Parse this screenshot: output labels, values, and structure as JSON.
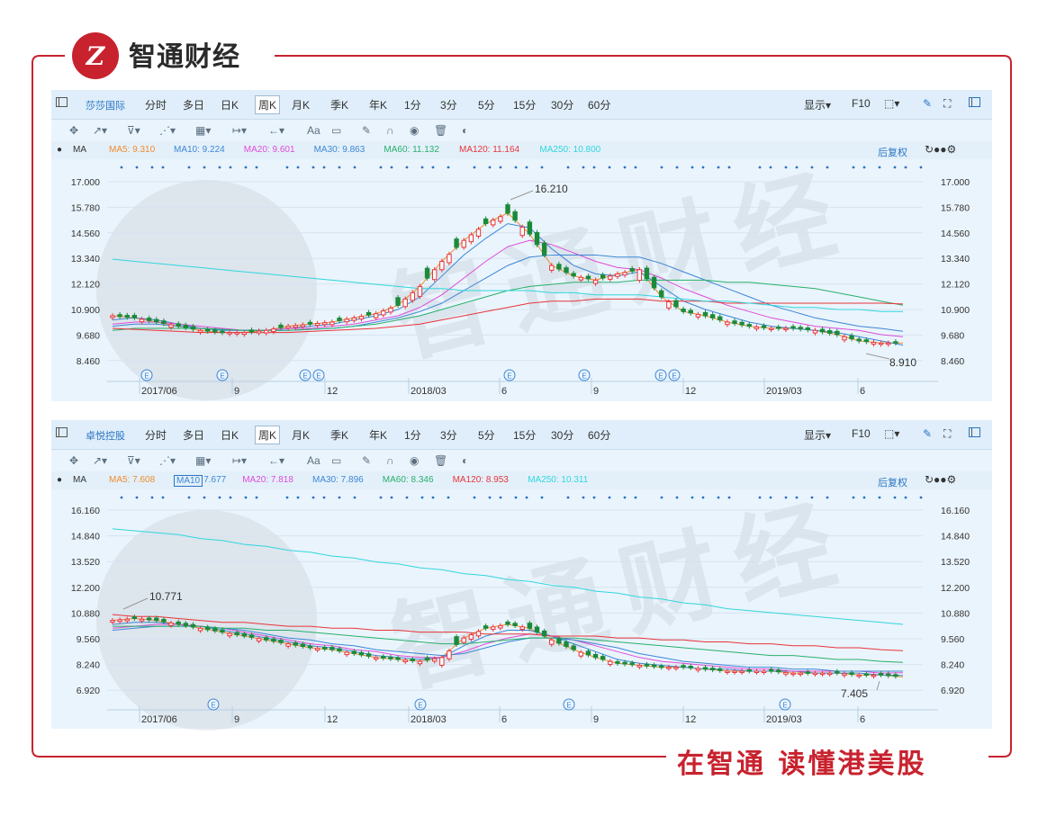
{
  "brand": {
    "name": "智通财经",
    "logo_letter": "Z",
    "slogan": "在智通 读懂港美股"
  },
  "colors": {
    "accent": "#c8222e",
    "panel_bg": "#eaf4fc",
    "up": "#e8343a",
    "down": "#1a8a3a"
  },
  "watermark": {
    "text": "智通财经"
  },
  "toolbar": {
    "periods": [
      "分时",
      "多日",
      "日K",
      "周K",
      "月K",
      "季K",
      "年K",
      "1分",
      "3分",
      "5分",
      "15分",
      "30分",
      "60分"
    ],
    "active_period": "周K",
    "display_label": "显示▾",
    "f10_label": "F10",
    "tool_glyphs": [
      "✥",
      "↗▾",
      "⊽▾",
      "⋰▾",
      "▦▾",
      "↦▾",
      "←▾",
      "Aa",
      "▭",
      "✎",
      "∩",
      "◉",
      "🗑",
      "◐"
    ]
  },
  "charts": [
    {
      "stock_name": "莎莎国际",
      "ma_label": "MA",
      "ma_values": [
        {
          "label": "MA5: 9.310",
          "color": "#f08b2b"
        },
        {
          "label": "MA10: 9.224",
          "color": "#3c86d6"
        },
        {
          "label": "MA20: 9.601",
          "color": "#e04bd8"
        },
        {
          "label": "MA30: 9.863",
          "color": "#3c86d6"
        },
        {
          "label": "MA60: 11.132",
          "color": "#27b06b"
        },
        {
          "label": "MA120: 11.164",
          "color": "#e8343a"
        },
        {
          "label": "MA250: 10.800",
          "color": "#31d6dd"
        }
      ],
      "adjust_label": "后复权",
      "y_ticks": [
        "17.000",
        "15.780",
        "14.560",
        "13.340",
        "12.120",
        "10.900",
        "9.680",
        "8.460"
      ],
      "x_ticks": [
        "2017/06",
        "9",
        "12",
        "2018/03",
        "6",
        "9",
        "12",
        "2019/03",
        "6"
      ],
      "max_label": "16.210",
      "min_label": "8.910",
      "event_marker": "E"
    },
    {
      "stock_name": "卓悦控股",
      "ma_label": "MA",
      "ma_values": [
        {
          "label": "MA5: 7.608",
          "color": "#f08b2b"
        },
        {
          "label": "MA10",
          "color": "#3c86d6",
          "boxed": true
        },
        {
          "label": "7.677",
          "color": "#3c86d6"
        },
        {
          "label": "MA20: 7.818",
          "color": "#e04bd8"
        },
        {
          "label": "MA30: 7.896",
          "color": "#3c86d6"
        },
        {
          "label": "MA60: 8.346",
          "color": "#27b06b"
        },
        {
          "label": "MA120: 8.953",
          "color": "#e8343a"
        },
        {
          "label": "MA250: 10.311",
          "color": "#31d6dd"
        }
      ],
      "adjust_label": "后复权",
      "y_ticks": [
        "16.160",
        "14.840",
        "13.520",
        "12.200",
        "10.880",
        "9.560",
        "8.240",
        "6.920"
      ],
      "x_ticks": [
        "2017/06",
        "9",
        "12",
        "2018/03",
        "6",
        "9",
        "12",
        "2019/03",
        "6"
      ],
      "max_label": "10.771",
      "min_label": "7.405",
      "event_marker": "E"
    }
  ],
  "chart_data": [
    {
      "type": "line",
      "title": "",
      "candlestick": true,
      "y_axis": [
        8.46,
        17.0
      ],
      "x_axis": [
        "2017/06",
        "9",
        "12",
        "2018/03",
        "6",
        "9",
        "12",
        "2019/03",
        "6"
      ],
      "annotations": [
        {
          "label": "16.210",
          "kind": "max"
        },
        {
          "label": "8.910",
          "kind": "min"
        }
      ],
      "series": [
        {
          "name": "MA5",
          "color": "#f08b2b",
          "values": [
            10.6,
            10.5,
            10.3,
            10.1,
            9.9,
            9.8,
            9.8,
            9.9,
            10.1,
            10.2,
            10.3,
            10.5,
            10.7,
            11.1,
            12.0,
            13.2,
            14.2,
            15.0,
            15.5,
            14.5,
            13.0,
            12.5,
            12.3,
            12.6,
            12.8,
            11.5,
            10.8,
            10.6,
            10.3,
            10.1,
            10.0,
            10.0,
            9.9,
            9.7,
            9.4,
            9.3,
            9.3
          ]
        },
        {
          "name": "MA10",
          "color": "#3c86d6",
          "values": [
            10.4,
            10.5,
            10.4,
            10.2,
            10.0,
            9.9,
            9.9,
            9.9,
            10.0,
            10.1,
            10.2,
            10.4,
            10.6,
            10.9,
            11.5,
            12.5,
            13.5,
            14.3,
            15.0,
            14.8,
            13.8,
            13.0,
            12.6,
            12.5,
            12.7,
            12.0,
            11.3,
            10.9,
            10.6,
            10.3,
            10.1,
            10.0,
            9.9,
            9.8,
            9.6,
            9.4,
            9.2
          ]
        },
        {
          "name": "MA20",
          "color": "#e04bd8",
          "values": [
            10.2,
            10.3,
            10.3,
            10.2,
            10.1,
            10.0,
            9.9,
            9.9,
            10.0,
            10.0,
            10.1,
            10.2,
            10.4,
            10.6,
            11.0,
            11.6,
            12.4,
            13.2,
            13.9,
            14.2,
            14.0,
            13.6,
            13.2,
            12.9,
            12.8,
            12.4,
            11.9,
            11.5,
            11.1,
            10.8,
            10.5,
            10.3,
            10.1,
            10.0,
            9.9,
            9.7,
            9.6
          ]
        },
        {
          "name": "MA30",
          "color": "#3c86d6",
          "values": [
            10.1,
            10.2,
            10.2,
            10.1,
            10.0,
            9.95,
            9.9,
            9.9,
            9.9,
            9.95,
            10.0,
            10.1,
            10.3,
            10.5,
            10.8,
            11.2,
            11.8,
            12.4,
            13.0,
            13.4,
            13.5,
            13.5,
            13.5,
            13.4,
            13.4,
            13.1,
            12.7,
            12.3,
            11.9,
            11.5,
            11.1,
            10.8,
            10.5,
            10.3,
            10.1,
            10.0,
            9.86
          ]
        },
        {
          "name": "MA60",
          "color": "#27b06b",
          "values": [
            9.9,
            10.0,
            10.0,
            10.0,
            10.0,
            9.95,
            9.9,
            9.9,
            9.9,
            9.95,
            10.0,
            10.1,
            10.2,
            10.4,
            10.6,
            10.9,
            11.2,
            11.5,
            11.8,
            12.0,
            12.1,
            12.2,
            12.2,
            12.2,
            12.3,
            12.3,
            12.3,
            12.3,
            12.2,
            12.2,
            12.1,
            12.0,
            11.9,
            11.7,
            11.5,
            11.3,
            11.1
          ]
        },
        {
          "name": "MA120",
          "color": "#e8343a",
          "values": [
            10.0,
            9.95,
            9.9,
            9.85,
            9.8,
            9.8,
            9.8,
            9.8,
            9.8,
            9.85,
            9.9,
            9.95,
            10.0,
            10.1,
            10.2,
            10.4,
            10.6,
            10.8,
            11.0,
            11.2,
            11.3,
            11.3,
            11.4,
            11.4,
            11.4,
            11.3,
            11.3,
            11.3,
            11.2,
            11.2,
            11.2,
            11.2,
            11.2,
            11.2,
            11.2,
            11.2,
            11.16
          ]
        },
        {
          "name": "MA250",
          "color": "#31d6dd",
          "values": [
            13.3,
            13.2,
            13.1,
            13.0,
            12.9,
            12.8,
            12.7,
            12.6,
            12.5,
            12.4,
            12.3,
            12.2,
            12.1,
            12.0,
            11.9,
            11.9,
            11.8,
            11.8,
            11.8,
            11.8,
            11.7,
            11.7,
            11.6,
            11.6,
            11.6,
            11.5,
            11.4,
            11.3,
            11.3,
            11.2,
            11.1,
            11.0,
            11.0,
            10.9,
            10.9,
            10.8,
            10.8
          ]
        }
      ]
    },
    {
      "type": "line",
      "title": "",
      "candlestick": true,
      "y_axis": [
        6.92,
        16.16
      ],
      "x_axis": [
        "2017/06",
        "9",
        "12",
        "2018/03",
        "6",
        "9",
        "12",
        "2019/03",
        "6"
      ],
      "annotations": [
        {
          "label": "10.771",
          "kind": "max"
        },
        {
          "label": "7.405",
          "kind": "min"
        }
      ],
      "series": [
        {
          "name": "MA5",
          "color": "#f08b2b",
          "values": [
            10.5,
            10.6,
            10.5,
            10.3,
            10.1,
            9.9,
            9.7,
            9.5,
            9.3,
            9.1,
            9.0,
            8.8,
            8.6,
            8.5,
            8.4,
            8.6,
            9.6,
            10.1,
            10.3,
            10.1,
            9.5,
            9.0,
            8.6,
            8.3,
            8.2,
            8.1,
            8.1,
            8.0,
            7.9,
            7.9,
            7.9,
            7.8,
            7.8,
            7.8,
            7.7,
            7.7,
            7.6
          ]
        },
        {
          "name": "MA10",
          "color": "#3c86d6",
          "values": [
            10.3,
            10.4,
            10.4,
            10.3,
            10.2,
            10.0,
            9.8,
            9.6,
            9.4,
            9.2,
            9.1,
            8.9,
            8.7,
            8.6,
            8.5,
            8.6,
            9.2,
            9.7,
            10.0,
            10.0,
            9.7,
            9.3,
            8.9,
            8.5,
            8.3,
            8.2,
            8.1,
            8.0,
            8.0,
            7.9,
            7.9,
            7.9,
            7.8,
            7.8,
            7.8,
            7.7,
            7.68
          ]
        },
        {
          "name": "MA20",
          "color": "#e04bd8",
          "values": [
            10.1,
            10.2,
            10.3,
            10.3,
            10.2,
            10.1,
            9.9,
            9.7,
            9.5,
            9.3,
            9.2,
            9.0,
            8.9,
            8.7,
            8.6,
            8.6,
            8.9,
            9.3,
            9.6,
            9.8,
            9.7,
            9.5,
            9.2,
            8.9,
            8.6,
            8.4,
            8.3,
            8.2,
            8.1,
            8.0,
            8.0,
            7.9,
            7.9,
            7.9,
            7.9,
            7.8,
            7.82
          ]
        },
        {
          "name": "MA30",
          "color": "#3c86d6",
          "values": [
            10.0,
            10.1,
            10.2,
            10.2,
            10.2,
            10.1,
            10.0,
            9.8,
            9.6,
            9.5,
            9.3,
            9.2,
            9.0,
            8.9,
            8.8,
            8.7,
            8.8,
            9.1,
            9.4,
            9.6,
            9.6,
            9.5,
            9.3,
            9.1,
            8.8,
            8.6,
            8.4,
            8.3,
            8.2,
            8.1,
            8.1,
            8.0,
            8.0,
            7.9,
            7.9,
            7.9,
            7.9
          ]
        },
        {
          "name": "MA60",
          "color": "#27b06b",
          "values": [
            10.2,
            10.2,
            10.2,
            10.2,
            10.2,
            10.1,
            10.1,
            10.0,
            10.0,
            9.9,
            9.8,
            9.7,
            9.6,
            9.5,
            9.4,
            9.3,
            9.3,
            9.4,
            9.5,
            9.6,
            9.6,
            9.6,
            9.5,
            9.4,
            9.3,
            9.2,
            9.1,
            9.0,
            8.9,
            8.8,
            8.7,
            8.7,
            8.6,
            8.5,
            8.5,
            8.4,
            8.35
          ]
        },
        {
          "name": "MA120",
          "color": "#e8343a",
          "values": [
            10.8,
            10.7,
            10.7,
            10.6,
            10.5,
            10.4,
            10.4,
            10.3,
            10.2,
            10.2,
            10.1,
            10.1,
            10.0,
            10.0,
            9.9,
            9.9,
            9.9,
            9.8,
            9.8,
            9.8,
            9.7,
            9.7,
            9.7,
            9.6,
            9.6,
            9.5,
            9.5,
            9.4,
            9.4,
            9.3,
            9.3,
            9.2,
            9.2,
            9.1,
            9.1,
            9.0,
            8.95
          ]
        },
        {
          "name": "MA250",
          "color": "#31d6dd",
          "values": [
            15.2,
            15.1,
            15.0,
            14.9,
            14.7,
            14.6,
            14.4,
            14.3,
            14.1,
            14.0,
            13.8,
            13.7,
            13.5,
            13.4,
            13.2,
            13.1,
            12.9,
            12.8,
            12.6,
            12.5,
            12.3,
            12.2,
            12.0,
            11.9,
            11.7,
            11.6,
            11.4,
            11.3,
            11.1,
            11.0,
            10.9,
            10.8,
            10.7,
            10.6,
            10.5,
            10.4,
            10.3
          ]
        }
      ]
    }
  ]
}
